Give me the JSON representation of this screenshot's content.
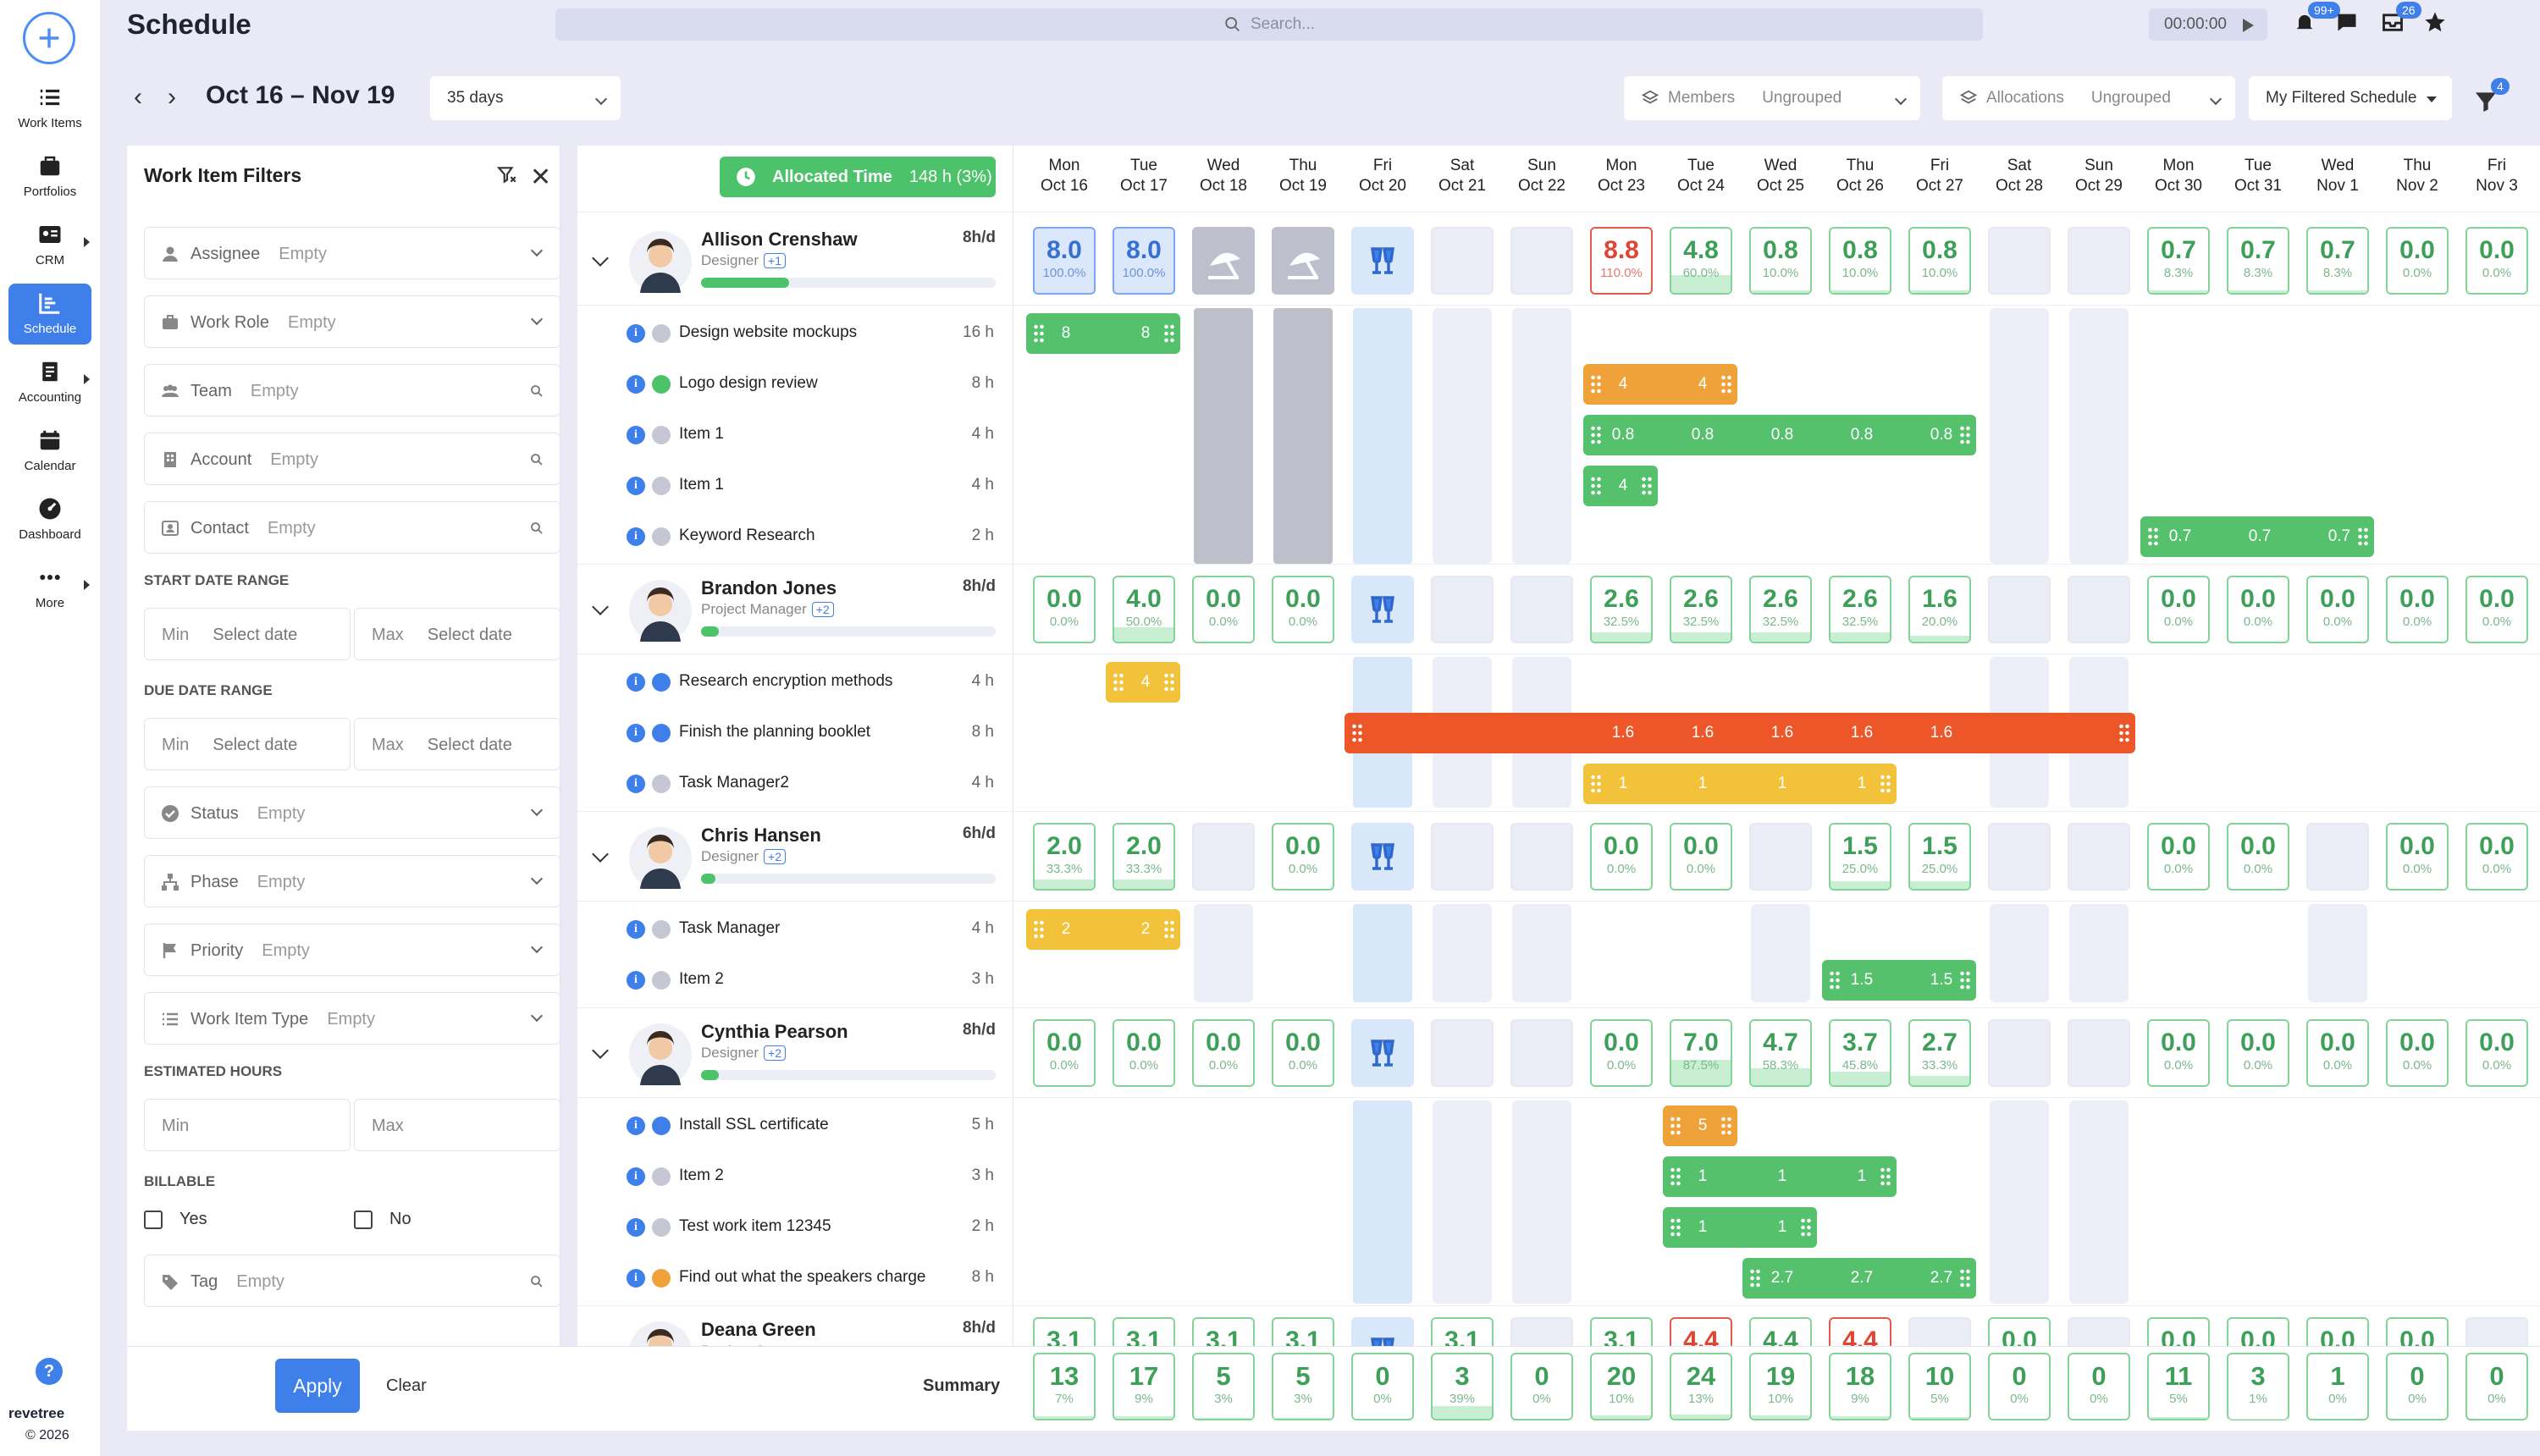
{
  "app": {
    "title": "Schedule",
    "search_placeholder": "Search...",
    "timer": "00:00:00",
    "notif_badge": "99+",
    "inbox_badge": "26"
  },
  "nav": {
    "items": [
      {
        "label": "Work Items",
        "icon": "work-items-icon"
      },
      {
        "label": "Portfolios",
        "icon": "portfolios-icon"
      },
      {
        "label": "CRM",
        "icon": "crm-icon"
      },
      {
        "label": "Schedule",
        "icon": "schedule-icon"
      },
      {
        "label": "Accounting",
        "icon": "accounting-icon"
      },
      {
        "label": "Calendar",
        "icon": "calendar-icon"
      },
      {
        "label": "Dashboard",
        "icon": "dashboard-icon"
      },
      {
        "label": "More",
        "icon": "more-icon"
      }
    ],
    "brand": "revetree",
    "copyright": "© 2026"
  },
  "toolbar": {
    "date_range": "Oct 16 – Nov 19",
    "span": "35 days",
    "members_label": "Members",
    "members_value": "Ungrouped",
    "allocations_label": "Allocations",
    "allocations_value": "Ungrouped",
    "view": "My Filtered Schedule",
    "filter_badge": "4"
  },
  "filters": {
    "title": "Work Item Filters",
    "fields": {
      "assignee": {
        "label": "Assignee",
        "value": "Empty"
      },
      "work_role": {
        "label": "Work Role",
        "value": "Empty"
      },
      "team": {
        "label": "Team",
        "value": "Empty"
      },
      "account": {
        "label": "Account",
        "value": "Empty"
      },
      "contact": {
        "label": "Contact",
        "value": "Empty"
      },
      "status": {
        "label": "Status",
        "value": "Empty"
      },
      "phase": {
        "label": "Phase",
        "value": "Empty"
      },
      "priority": {
        "label": "Priority",
        "value": "Empty"
      },
      "work_item_type": {
        "label": "Work Item Type",
        "value": "Empty"
      },
      "tag": {
        "label": "Tag",
        "value": "Empty"
      }
    },
    "start_date_range": "START DATE RANGE",
    "due_date_range": "DUE DATE RANGE",
    "estimated_hours": "ESTIMATED HOURS",
    "billable": "BILLABLE",
    "min": "Min",
    "max": "Max",
    "select_date": "Select date",
    "yes": "Yes",
    "no": "No",
    "apply": "Apply",
    "clear": "Clear"
  },
  "allocated": {
    "label": "Allocated Time",
    "value": "148 h (3%)"
  },
  "days": [
    {
      "dow": "Mon",
      "date": "Oct 16"
    },
    {
      "dow": "Tue",
      "date": "Oct 17"
    },
    {
      "dow": "Wed",
      "date": "Oct 18"
    },
    {
      "dow": "Thu",
      "date": "Oct 19"
    },
    {
      "dow": "Fri",
      "date": "Oct 20"
    },
    {
      "dow": "Sat",
      "date": "Oct 21"
    },
    {
      "dow": "Sun",
      "date": "Oct 22"
    },
    {
      "dow": "Mon",
      "date": "Oct 23"
    },
    {
      "dow": "Tue",
      "date": "Oct 24"
    },
    {
      "dow": "Wed",
      "date": "Oct 25"
    },
    {
      "dow": "Thu",
      "date": "Oct 26"
    },
    {
      "dow": "Fri",
      "date": "Oct 27"
    },
    {
      "dow": "Sat",
      "date": "Oct 28"
    },
    {
      "dow": "Sun",
      "date": "Oct 29"
    },
    {
      "dow": "Mon",
      "date": "Oct 30"
    },
    {
      "dow": "Tue",
      "date": "Oct 31"
    },
    {
      "dow": "Wed",
      "date": "Nov 1"
    },
    {
      "dow": "Thu",
      "date": "Nov 2"
    },
    {
      "dow": "Fri",
      "date": "Nov 3"
    }
  ],
  "people": [
    {
      "name": "Allison Crenshaw",
      "role": "Designer",
      "extra": "+1",
      "hpd": "8h/d",
      "load": 0.3,
      "cells": [
        [
          "8.0",
          "100.0%",
          "blue"
        ],
        [
          "8.0",
          "100.0%",
          "blue"
        ],
        [
          "",
          "",
          "holiday"
        ],
        [
          "",
          "",
          "holiday"
        ],
        [
          "",
          "",
          "event"
        ],
        [
          "",
          "",
          "grey"
        ],
        [
          "",
          "",
          "grey"
        ],
        [
          "8.8",
          "110.0%",
          "red"
        ],
        [
          "4.8",
          "60.0%",
          ""
        ],
        [
          "0.8",
          "10.0%",
          ""
        ],
        [
          "0.8",
          "10.0%",
          ""
        ],
        [
          "0.8",
          "10.0%",
          ""
        ],
        [
          "",
          "",
          "grey"
        ],
        [
          "",
          "",
          "grey"
        ],
        [
          "0.7",
          "8.3%",
          ""
        ],
        [
          "0.7",
          "8.3%",
          ""
        ],
        [
          "0.7",
          "8.3%",
          ""
        ],
        [
          "0.0",
          "0.0%",
          ""
        ],
        [
          "0.0",
          "0.0%",
          ""
        ]
      ],
      "tasks": [
        {
          "name": "Design website mockups",
          "hours": "16 h",
          "status": "grey",
          "bars": [
            {
              "start": 0,
              "end": 2,
              "color": "green",
              "labels": [
                "8",
                "8"
              ]
            }
          ]
        },
        {
          "name": "Logo design review",
          "hours": "8 h",
          "status": "green",
          "bars": [
            {
              "start": 7,
              "end": 9,
              "color": "orange",
              "labels": [
                "4",
                "4"
              ]
            }
          ]
        },
        {
          "name": "Item 1",
          "hours": "4 h",
          "status": "grey",
          "bars": [
            {
              "start": 7,
              "end": 12,
              "color": "green",
              "labels": [
                "0.8",
                "0.8",
                "0.8",
                "0.8",
                "0.8"
              ]
            }
          ]
        },
        {
          "name": "Item 1",
          "hours": "4 h",
          "status": "grey",
          "bars": [
            {
              "start": 7,
              "end": 8,
              "color": "green",
              "labels": [
                "4"
              ]
            }
          ]
        },
        {
          "name": "Keyword Research",
          "hours": "2 h",
          "status": "grey",
          "bars": [
            {
              "start": 14,
              "end": 17,
              "color": "green",
              "labels": [
                "0.7",
                "0.7",
                "0.7"
              ]
            }
          ]
        }
      ]
    },
    {
      "name": "Brandon Jones",
      "role": "Project Manager",
      "extra": "+2",
      "hpd": "8h/d",
      "load": 0.06,
      "cells": [
        [
          "0.0",
          "0.0%",
          ""
        ],
        [
          "4.0",
          "50.0%",
          ""
        ],
        [
          "0.0",
          "0.0%",
          ""
        ],
        [
          "0.0",
          "0.0%",
          ""
        ],
        [
          "",
          "",
          "event"
        ],
        [
          "",
          "",
          "grey"
        ],
        [
          "",
          "",
          "grey"
        ],
        [
          "2.6",
          "32.5%",
          ""
        ],
        [
          "2.6",
          "32.5%",
          ""
        ],
        [
          "2.6",
          "32.5%",
          ""
        ],
        [
          "2.6",
          "32.5%",
          ""
        ],
        [
          "1.6",
          "20.0%",
          ""
        ],
        [
          "",
          "",
          "grey"
        ],
        [
          "",
          "",
          "grey"
        ],
        [
          "0.0",
          "0.0%",
          ""
        ],
        [
          "0.0",
          "0.0%",
          ""
        ],
        [
          "0.0",
          "0.0%",
          ""
        ],
        [
          "0.0",
          "0.0%",
          ""
        ],
        [
          "0.0",
          "0.0%",
          ""
        ]
      ],
      "tasks": [
        {
          "name": "Research encryption methods",
          "hours": "4 h",
          "status": "blue",
          "bars": [
            {
              "start": 1,
              "end": 2,
              "color": "yellow",
              "labels": [
                "4"
              ]
            }
          ]
        },
        {
          "name": "Finish the planning booklet",
          "hours": "8 h",
          "status": "blue",
          "bars": [
            {
              "start": 4,
              "end": 14,
              "color": "red",
              "labels": [
                "",
                "",
                "",
                "1.6",
                "1.6",
                "1.6",
                "1.6",
                "1.6",
                "",
                ""
              ]
            }
          ]
        },
        {
          "name": "Task Manager2",
          "hours": "4 h",
          "status": "grey",
          "bars": [
            {
              "start": 7,
              "end": 11,
              "color": "yellow",
              "labels": [
                "1",
                "1",
                "1",
                "1"
              ]
            }
          ]
        }
      ]
    },
    {
      "name": "Chris Hansen",
      "role": "Designer",
      "extra": "+2",
      "hpd": "6h/d",
      "load": 0.05,
      "cells": [
        [
          "2.0",
          "33.3%",
          ""
        ],
        [
          "2.0",
          "33.3%",
          ""
        ],
        [
          "",
          "",
          "grey"
        ],
        [
          "0.0",
          "0.0%",
          ""
        ],
        [
          "",
          "",
          "event"
        ],
        [
          "",
          "",
          "grey"
        ],
        [
          "",
          "",
          "grey"
        ],
        [
          "0.0",
          "0.0%",
          ""
        ],
        [
          "0.0",
          "0.0%",
          ""
        ],
        [
          "",
          "",
          "grey"
        ],
        [
          "1.5",
          "25.0%",
          ""
        ],
        [
          "1.5",
          "25.0%",
          ""
        ],
        [
          "",
          "",
          "grey"
        ],
        [
          "",
          "",
          "grey"
        ],
        [
          "0.0",
          "0.0%",
          ""
        ],
        [
          "0.0",
          "0.0%",
          ""
        ],
        [
          "",
          "",
          "grey"
        ],
        [
          "0.0",
          "0.0%",
          ""
        ],
        [
          "0.0",
          "0.0%",
          ""
        ]
      ],
      "tasks": [
        {
          "name": "Task Manager",
          "hours": "4 h",
          "status": "grey",
          "bars": [
            {
              "start": 0,
              "end": 2,
              "color": "yellow",
              "labels": [
                "2",
                "2"
              ]
            }
          ]
        },
        {
          "name": "Item 2",
          "hours": "3 h",
          "status": "grey",
          "bars": [
            {
              "start": 10,
              "end": 12,
              "color": "green",
              "labels": [
                "1.5",
                "1.5"
              ]
            }
          ]
        }
      ]
    },
    {
      "name": "Cynthia Pearson",
      "role": "Designer",
      "extra": "+2",
      "hpd": "8h/d",
      "load": 0.06,
      "cells": [
        [
          "0.0",
          "0.0%",
          ""
        ],
        [
          "0.0",
          "0.0%",
          ""
        ],
        [
          "0.0",
          "0.0%",
          ""
        ],
        [
          "0.0",
          "0.0%",
          ""
        ],
        [
          "",
          "",
          "event"
        ],
        [
          "",
          "",
          "grey"
        ],
        [
          "",
          "",
          "grey"
        ],
        [
          "0.0",
          "0.0%",
          ""
        ],
        [
          "7.0",
          "87.5%",
          ""
        ],
        [
          "4.7",
          "58.3%",
          ""
        ],
        [
          "3.7",
          "45.8%",
          ""
        ],
        [
          "2.7",
          "33.3%",
          ""
        ],
        [
          "",
          "",
          "grey"
        ],
        [
          "",
          "",
          "grey"
        ],
        [
          "0.0",
          "0.0%",
          ""
        ],
        [
          "0.0",
          "0.0%",
          ""
        ],
        [
          "0.0",
          "0.0%",
          ""
        ],
        [
          "0.0",
          "0.0%",
          ""
        ],
        [
          "0.0",
          "0.0%",
          ""
        ]
      ],
      "tasks": [
        {
          "name": "Install SSL certificate",
          "hours": "5 h",
          "status": "blue",
          "bars": [
            {
              "start": 8,
              "end": 9,
              "color": "orange",
              "labels": [
                "5"
              ]
            }
          ]
        },
        {
          "name": "Item 2",
          "hours": "3 h",
          "status": "grey",
          "bars": [
            {
              "start": 8,
              "end": 11,
              "color": "green",
              "labels": [
                "1",
                "1",
                "1"
              ]
            }
          ]
        },
        {
          "name": "Test work item 12345",
          "hours": "2 h",
          "status": "grey",
          "bars": [
            {
              "start": 8,
              "end": 10,
              "color": "green",
              "labels": [
                "1",
                "1"
              ]
            }
          ]
        },
        {
          "name": "Find out what the speakers charge",
          "hours": "8 h",
          "status": "orange",
          "bars": [
            {
              "start": 9,
              "end": 12,
              "color": "green",
              "labels": [
                "2.7",
                "2.7",
                "2.7"
              ]
            }
          ]
        }
      ]
    },
    {
      "name": "Deana Green",
      "role": "Product Owner",
      "extra": "",
      "hpd": "8h/d",
      "load": 0,
      "cells": [
        [
          "3.1",
          "",
          ""
        ],
        [
          "3.1",
          "",
          ""
        ],
        [
          "3.1",
          "",
          ""
        ],
        [
          "3.1",
          "",
          ""
        ],
        [
          "",
          "",
          "event"
        ],
        [
          "3.1",
          "",
          ""
        ],
        [
          "",
          "",
          "grey"
        ],
        [
          "3.1",
          "",
          ""
        ],
        [
          "4.4",
          "",
          "red"
        ],
        [
          "4.4",
          "",
          ""
        ],
        [
          "4.4",
          "",
          "red"
        ],
        [
          "",
          "",
          "grey"
        ],
        [
          "0.0",
          "",
          ""
        ],
        [
          "",
          "",
          "grey"
        ],
        [
          "0.0",
          "",
          ""
        ],
        [
          "0.0",
          "",
          ""
        ],
        [
          "0.0",
          "",
          ""
        ],
        [
          "0.0",
          "",
          ""
        ],
        [
          "",
          "",
          "grey"
        ]
      ],
      "tasks": []
    }
  ],
  "summary": {
    "label": "Summary",
    "values": [
      [
        "13",
        "7%"
      ],
      [
        "17",
        "9%"
      ],
      [
        "5",
        "3%"
      ],
      [
        "5",
        "3%"
      ],
      [
        "0",
        "0%"
      ],
      [
        "3",
        "39%"
      ],
      [
        "0",
        "0%"
      ],
      [
        "20",
        "10%"
      ],
      [
        "24",
        "13%"
      ],
      [
        "19",
        "10%"
      ],
      [
        "18",
        "9%"
      ],
      [
        "10",
        "5%"
      ],
      [
        "0",
        "0%"
      ],
      [
        "0",
        "0%"
      ],
      [
        "11",
        "5%"
      ],
      [
        "3",
        "1%"
      ],
      [
        "1",
        "0%"
      ],
      [
        "0",
        "0%"
      ],
      [
        "0",
        "0%"
      ]
    ]
  }
}
